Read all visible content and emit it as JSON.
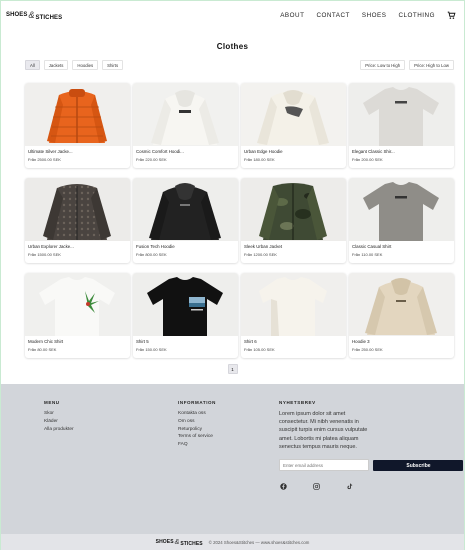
{
  "header": {
    "logo_left": "SHOES",
    "logo_amp": "&",
    "logo_right": "STICHES",
    "nav": [
      "ABOUT",
      "CONTACT",
      "SHOES",
      "CLOTHING"
    ]
  },
  "main": {
    "title": "Clothes",
    "filters": [
      "All",
      "Jackets",
      "Hoodies",
      "Shirts"
    ],
    "active_filter": "All",
    "sort": [
      "Price: Low to High",
      "Price: High to Low"
    ],
    "products": [
      {
        "name": "Ultimate Silver Jacke...",
        "price": "Från 2500.00 SEK"
      },
      {
        "name": "Cosmic Comfort Hoodi...",
        "price": "Från 220.00 SEK"
      },
      {
        "name": "Urban Edge Hoodie",
        "price": "Från 180.00 SEK"
      },
      {
        "name": "Elegant Classic Shir...",
        "price": "Från 200.00 SEK"
      },
      {
        "name": "Urban Explorer Jacke...",
        "price": "Från 1500.00 SEK"
      },
      {
        "name": "Fusion Tech Hoodie",
        "price": "Från 800.00 SEK"
      },
      {
        "name": "Sleek Urban Jacket",
        "price": "Från 1200.00 SEK"
      },
      {
        "name": "Classic Casual Shirt",
        "price": "Från 110.00 SEK"
      },
      {
        "name": "Modern Chic Shirt",
        "price": "Från 80.00 SEK"
      },
      {
        "name": "Shirt 5",
        "price": "Från 150.00 SEK"
      },
      {
        "name": "Shirt 6",
        "price": "Från 105.00 SEK"
      },
      {
        "name": "Hoodie 3",
        "price": "Från 250.00 SEK"
      }
    ],
    "page": "1"
  },
  "footer": {
    "menu_heading": "MENU",
    "menu_links": [
      "Skor",
      "Kläder",
      "Alla produkter"
    ],
    "info_heading": "INFORMATION",
    "info_links": [
      "Kontakta oss",
      "Om oss",
      "Returpolicy",
      "Terms of service",
      "FAQ"
    ],
    "newsletter_heading": "NYHETSBREV",
    "newsletter_text": "Lorem ipsum dolor sit amet consectetur. Mi nibh venenatis in suscipit turpis enim cursus vulputate amet. Lobortis mi platea aliquam senectus tempus mauris neque.",
    "email_placeholder": "Enter email address",
    "subscribe_label": "Subscribe",
    "copyright": "© 2024 Shoes&Stitches — www.shoes&stitches.com"
  },
  "colors": {
    "footer_bg": "#d2d5da",
    "subscribe_bg": "#10172a"
  }
}
